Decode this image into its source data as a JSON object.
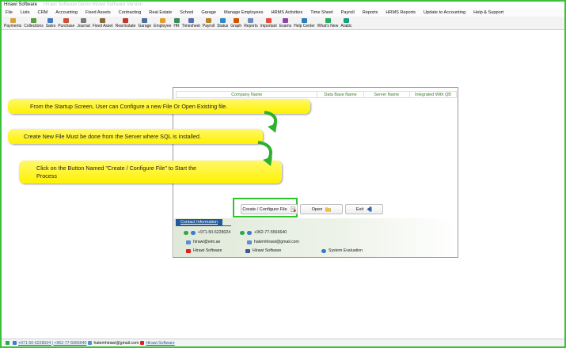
{
  "window": {
    "title": "Hirawi Software",
    "ghost_text": "Hirawi Software Demo  Hirawi Software Version"
  },
  "menu": [
    "File",
    "Lists",
    "CRM",
    "Accounting",
    "Fixed Assets",
    "Contracting",
    "Real Estate",
    "School",
    "Garage",
    "Manage Employees",
    "HRMS Activities",
    "Time Sheet",
    "Payroll",
    "Reports",
    "HRMS Reports",
    "Update to Accounting",
    "Help & Support"
  ],
  "toolbar": [
    "Payments",
    "Collections",
    "Sales",
    "Purchase",
    "Journal",
    "Fixed Asset",
    "Real Estate",
    "Garage",
    "Employee",
    "HR",
    "Timesheet",
    "Payroll",
    "Status",
    "Graph",
    "Reports",
    "Important",
    "Exams",
    "Help Center",
    "What's New",
    "Arabic"
  ],
  "grid": {
    "columns": [
      "Company Name",
      "Data Base Name",
      "Server Name",
      "Integrated With QB"
    ]
  },
  "buttons": {
    "create": "Create / Configure File",
    "open": "Open",
    "exit": "Exit"
  },
  "contact": {
    "tab": "Contact Information",
    "phone1": "+971-50-6228024",
    "phone2": "+962-77-5566640",
    "email1": "hirawi@eim.ae",
    "email2": "hatemhirawi@gmail.com",
    "youtube": "Hirawi Software",
    "facebook": "Hirawi Software",
    "evaluation": "System Evaluation"
  },
  "callouts": {
    "c1": "From the Startup Screen, User can Configure a new File Or Open Existing file.",
    "c2": "Create New File Must be done from the Server where SQL is installed.",
    "c3_line1": "Click on the Button Named \"Create / Configure File\" to Start the",
    "c3_line2": "Process"
  },
  "status": {
    "phones": "+971-50-6228024 | +962-77-5566640",
    "email": "hatemhirawi@gmail.com",
    "youtube": "Hirawi Software"
  },
  "colors": {
    "highlight": "#2ec52e",
    "callout": "#fff200",
    "contact_tab": "#1f5a9a",
    "grid_header_text": "#3a7a2a"
  }
}
